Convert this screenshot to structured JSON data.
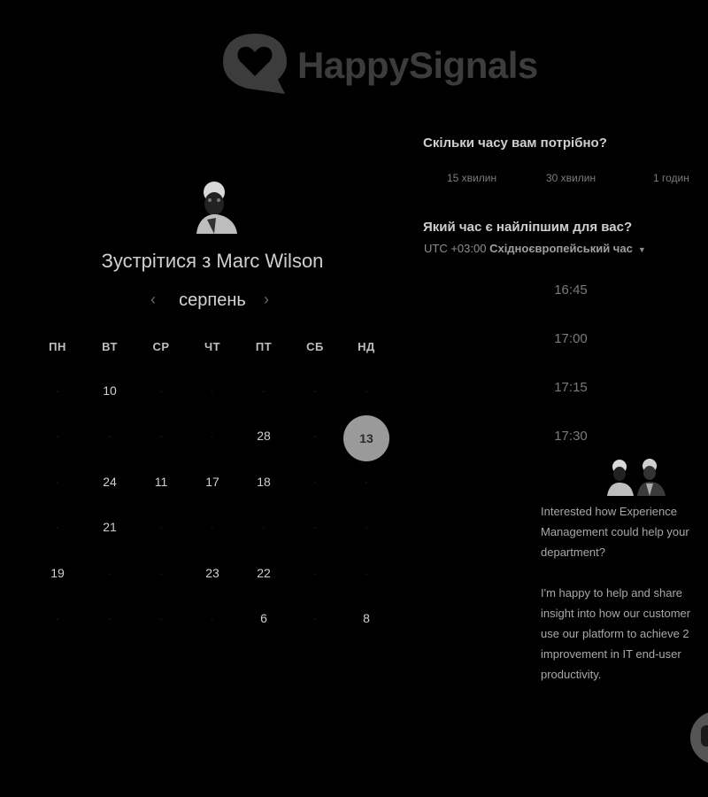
{
  "brand": {
    "name": "HappySignals",
    "logo_icon": "heart-bubble-icon"
  },
  "host": {
    "avatar": "person-avatar",
    "meet_prefix": "Зустрітися з ",
    "name": "Marc Wilson"
  },
  "calendar": {
    "month": "серпень",
    "prev_icon": "chevron-left-icon",
    "next_icon": "chevron-right-icon",
    "weekdays": [
      "ПН",
      "ВТ",
      "СР",
      "ЧТ",
      "ПТ",
      "СБ",
      "НД"
    ],
    "weeks": [
      [
        "",
        "10",
        "",
        "",
        "",
        "",
        ""
      ],
      [
        "",
        "",
        "",
        "",
        "28",
        "",
        "13"
      ],
      [
        "",
        "24",
        "11",
        "17",
        "18",
        "",
        ""
      ],
      [
        "",
        "21",
        "",
        "",
        "",
        "",
        ""
      ],
      [
        "19",
        "",
        "",
        "23",
        "22",
        "",
        ""
      ],
      [
        "",
        "",
        "",
        "",
        "6",
        "",
        "8"
      ]
    ],
    "selected_day": "13"
  },
  "duration": {
    "question": "Скільки часу вам потрібно?",
    "options": [
      "15 хвилин",
      "30 хвилин",
      "1 годин"
    ]
  },
  "time": {
    "question": "Який час є найліпшим для вас?",
    "tz_offset": "UTC +03:00",
    "tz_name": "Східноєвропейський час",
    "slots": [
      "16:45",
      "17:00",
      "17:15",
      "17:30"
    ]
  },
  "promo": {
    "avatars": "two-person-avatars",
    "p1": "Interested how Experience\nManagement could help your\ndepartment?",
    "p2": "I'm happy to help and share\ninsight into how our customer\nuse our platform to achieve 2\nimprovement in IT end-user\nproductivity."
  },
  "chat_icon": "chat-bubble-icon"
}
